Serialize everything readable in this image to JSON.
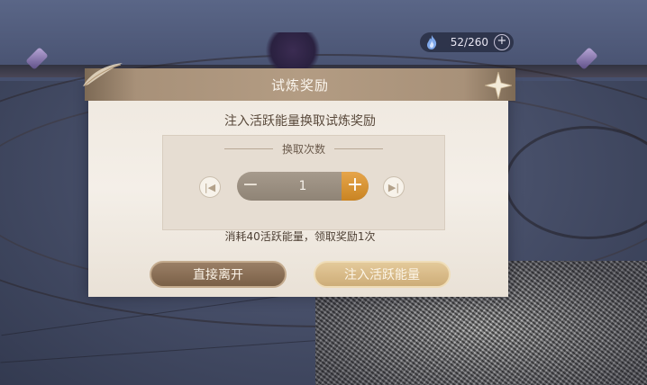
{
  "top_bar": {
    "energy_icon": "blue-flame-icon",
    "energy_value": "52/260",
    "add_symbol": "+"
  },
  "dialog": {
    "title": "试炼奖励",
    "subtitle": "注入活跃能量换取试炼奖励",
    "exchange_label": "换取次数",
    "first_symbol": "|◀",
    "last_symbol": "▶|",
    "minus_symbol": "−",
    "plus_symbol": "+",
    "quantity": "1",
    "cost_text": "消耗40活跃能量，领取奖励1次",
    "leave_button": "直接离开",
    "inject_button": "注入活跃能量"
  },
  "colors": {
    "panel_bg": "#efe8df",
    "title_bar": "#b39c83",
    "plus_accent": "#d9952f",
    "leave_button": "#8a6e55"
  }
}
